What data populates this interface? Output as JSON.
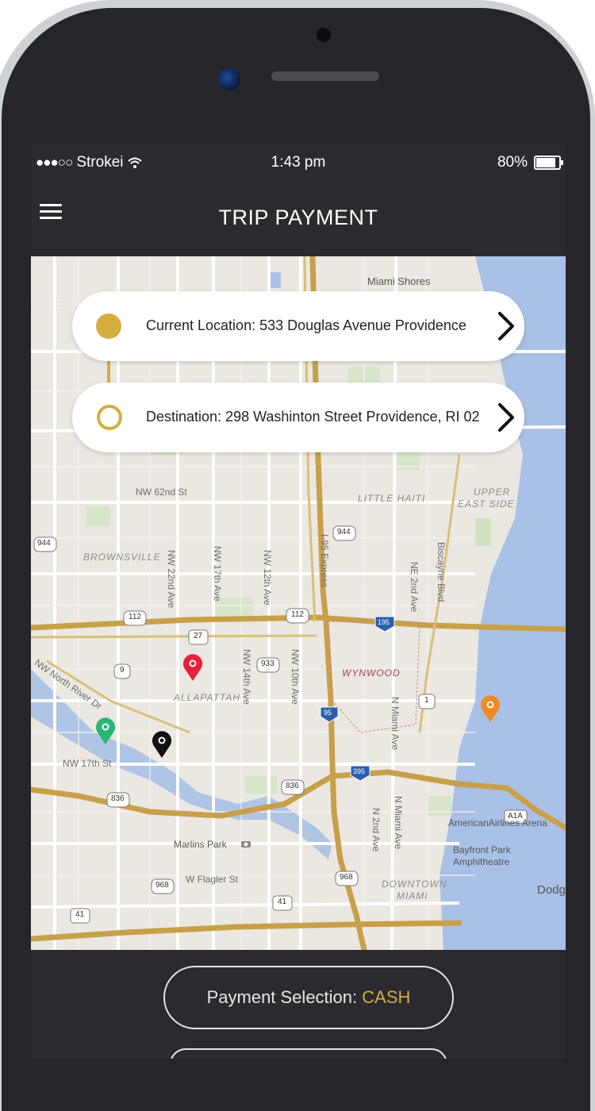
{
  "status_bar": {
    "signal": "●●●○○",
    "carrier": "Strokei",
    "time": "1:43 pm",
    "battery": "80%"
  },
  "nav": {
    "title": "TRIP PAYMENT",
    "menu_icon": "hamburger-menu-icon"
  },
  "route": {
    "current_location": "Current Location: 533 Douglas Avenue Providence",
    "destination": "Destination: 298 Washinton Street Providence, RI 02"
  },
  "map_labels": {
    "miami_shores": "Miami Shores",
    "nw_62nd": "NW 62nd St",
    "little_haiti": "LITTLE HAITI",
    "upper_east_side_1": "UPPER",
    "upper_east_side_2": "EAST SIDE",
    "brownsville": "BROWNSVILLE",
    "nw_22nd": "NW 22nd Ave",
    "nw_17th": "NW 17th Ave",
    "nw_12th": "NW 12th Ave",
    "i95": "I-95 Express",
    "ne_2nd": "NE 2nd Ave",
    "biscayne": "Biscayne Blvd",
    "wynwood": "WYNWOOD",
    "allapattah": "ALLAPATTAH",
    "nw_14th": "NW 14th Ave",
    "nw_10th": "NW 10th Ave",
    "nw_north_river": "NW North River Dr",
    "nw_17th_st": "NW 17th St",
    "n_miami": "N Miami Ave",
    "n_miami_2": "N Miami Ave",
    "n_2nd": "N 2nd Ave",
    "american_airlines": "AmericanAirlines Arena",
    "bayfront_1": "Bayfront Park",
    "bayfront_2": "Amphitheatre",
    "marlins_park": "Marlins Park",
    "w_flagler": "W Flagler St",
    "downtown": "DOWNTOWN",
    "miami": "MIAMI",
    "dodge": "Dodg",
    "shield_944": "944",
    "shield_112a": "112",
    "shield_112b": "112",
    "shield_27": "27",
    "shield_9": "9",
    "shield_933": "933",
    "shield_836a": "836",
    "shield_836b": "836",
    "shield_968a": "968",
    "shield_968b": "968",
    "shield_41a": "41",
    "shield_41b": "41",
    "shield_1": "1",
    "shield_95": "95",
    "shield_195": "195",
    "shield_395": "395",
    "shield_a1a": "A1A",
    "shield_944b": "944"
  },
  "payment": {
    "label": "Payment Selection: ",
    "value": "CASH"
  },
  "colors": {
    "accent": "#d4ad40",
    "dark_bg": "#2b2b2f",
    "pin_red": "#e8203a",
    "pin_green": "#2bb673",
    "pin_black": "#111111",
    "pin_orange": "#f08a24",
    "water": "#a9c1e6",
    "highway": "#c7a04a"
  }
}
